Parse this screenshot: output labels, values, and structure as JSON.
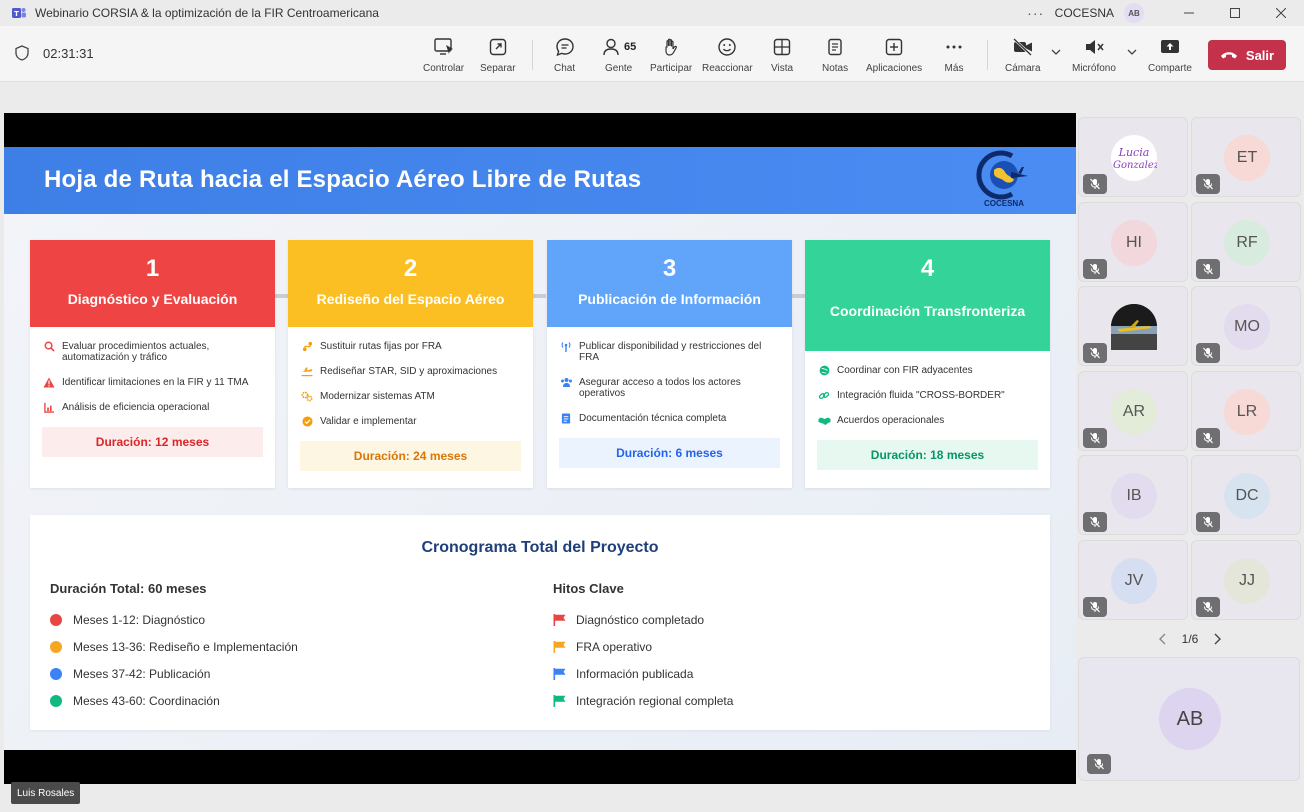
{
  "window": {
    "title": "Webinario CORSIA & la optimización de la FIR Centroamericana",
    "org": "COCESNA",
    "org_avatar": "AB"
  },
  "toolbar": {
    "timer": "02:31:31",
    "controlar": "Controlar",
    "separar": "Separar",
    "chat": "Chat",
    "gente": "Gente",
    "gente_count": "65",
    "participar": "Participar",
    "reaccionar": "Reaccionar",
    "vista": "Vista",
    "notas": "Notas",
    "aplicaciones": "Aplicaciones",
    "mas": "Más",
    "camara": "Cámara",
    "microfono": "Micrófono",
    "comparte": "Comparte",
    "salir": "Salir"
  },
  "slide": {
    "title": "Hoja de Ruta hacia el Espacio Aéreo Libre de Rutas",
    "logo_text": "COCESNA",
    "phases": [
      {
        "number": "1",
        "name": "Diagnóstico y Evaluación",
        "color": "#ef4444",
        "items": [
          {
            "icon": "search-icon",
            "text": "Evaluar procedimientos actuales, automatización y tráfico"
          },
          {
            "icon": "warning-icon",
            "text": "Identificar limitaciones en la FIR y 11 TMA"
          },
          {
            "icon": "chart-icon",
            "text": "Análisis de eficiencia operacional"
          }
        ],
        "duration": "Duración: 12 meses"
      },
      {
        "number": "2",
        "name": "Rediseño del Espacio Aéreo",
        "color": "#fbbf24",
        "items": [
          {
            "icon": "route-icon",
            "text": "Sustituir rutas fijas por FRA"
          },
          {
            "icon": "plane-icon",
            "text": "Rediseñar STAR, SID y aproximaciones"
          },
          {
            "icon": "gears-icon",
            "text": "Modernizar sistemas ATM"
          },
          {
            "icon": "check-circle-icon",
            "text": "Validar e implementar"
          }
        ],
        "duration": "Duración: 24 meses"
      },
      {
        "number": "3",
        "name": "Publicación de Información",
        "color": "#60a5fa",
        "items": [
          {
            "icon": "broadcast-icon",
            "text": "Publicar disponibilidad y restricciones del FRA"
          },
          {
            "icon": "users-icon",
            "text": "Asegurar acceso a todos los actores operativos"
          },
          {
            "icon": "document-icon",
            "text": "Documentación técnica completa"
          }
        ],
        "duration": "Duración: 6 meses"
      },
      {
        "number": "4",
        "name": "Coordinación Transfronteriza",
        "color": "#34d399",
        "items": [
          {
            "icon": "globe-icon",
            "text": "Coordinar con FIR adyacentes"
          },
          {
            "icon": "link-icon",
            "text": "Integración fluida \"CROSS-BORDER\""
          },
          {
            "icon": "handshake-icon",
            "text": "Acuerdos operacionales"
          }
        ],
        "duration": "Duración: 18 meses"
      }
    ],
    "summary": {
      "title": "Cronograma Total del Proyecto",
      "duration_title": "Duración Total: 60 meses",
      "milestones_title": "Hitos Clave",
      "periods": [
        {
          "text": "Meses 1-12: Diagnóstico",
          "color": "#e84545"
        },
        {
          "text": "Meses 13-36: Rediseño e Implementación",
          "color": "#f5a623"
        },
        {
          "text": "Meses 37-42: Publicación",
          "color": "#3b82f6"
        },
        {
          "text": "Meses 43-60: Coordinación",
          "color": "#10b981"
        }
      ],
      "milestones": [
        {
          "text": "Diagnóstico completado",
          "color": "#e84545"
        },
        {
          "text": "FRA operativo",
          "color": "#f5a623"
        },
        {
          "text": "Información publicada",
          "color": "#3b82f6"
        },
        {
          "text": "Integración regional completa",
          "color": "#10b981"
        }
      ]
    }
  },
  "participants": [
    {
      "initials": "",
      "bg": "#ffffff",
      "kind": "logo",
      "logo_text": "Lucia Gonzalez"
    },
    {
      "initials": "ET",
      "bg": "#f7d9d5"
    },
    {
      "initials": "HI",
      "bg": "#f2d7dc"
    },
    {
      "initials": "RF",
      "bg": "#d7ecdf"
    },
    {
      "initials": "",
      "bg": "#222222",
      "kind": "photo"
    },
    {
      "initials": "MO",
      "bg": "#e3dcef"
    },
    {
      "initials": "AR",
      "bg": "#e2ecd9"
    },
    {
      "initials": "LR",
      "bg": "#f7d9d5"
    },
    {
      "initials": "IB",
      "bg": "#e3dcef"
    },
    {
      "initials": "DC",
      "bg": "#d8e3f0"
    },
    {
      "initials": "JV",
      "bg": "#d6def2"
    },
    {
      "initials": "JJ",
      "bg": "#e5e6da"
    }
  ],
  "pager": "1/6",
  "self": {
    "initials": "AB"
  },
  "presenter": "Luis Rosales"
}
